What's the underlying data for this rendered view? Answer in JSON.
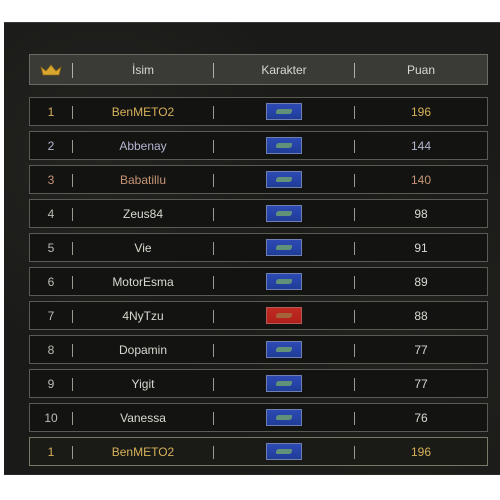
{
  "header": {
    "col_name": "İsim",
    "col_character": "Karakter",
    "col_points": "Puan",
    "rank_icon": "crown-icon"
  },
  "rows": [
    {
      "rank": "1",
      "name": "BenMETO2",
      "points": "196",
      "empire": "blue"
    },
    {
      "rank": "2",
      "name": "Abbenay",
      "points": "144",
      "empire": "blue"
    },
    {
      "rank": "3",
      "name": "Babatillu",
      "points": "140",
      "empire": "blue"
    },
    {
      "rank": "4",
      "name": "Zeus84",
      "points": "98",
      "empire": "blue"
    },
    {
      "rank": "5",
      "name": "Vie",
      "points": "91",
      "empire": "blue"
    },
    {
      "rank": "6",
      "name": "MotorEsma",
      "points": "89",
      "empire": "blue"
    },
    {
      "rank": "7",
      "name": "4NyTzu",
      "points": "88",
      "empire": "red"
    },
    {
      "rank": "8",
      "name": "Dopamin",
      "points": "77",
      "empire": "blue"
    },
    {
      "rank": "9",
      "name": "Yigit",
      "points": "77",
      "empire": "blue"
    },
    {
      "rank": "10",
      "name": "Vanessa",
      "points": "76",
      "empire": "blue"
    }
  ],
  "self_row": {
    "rank": "1",
    "name": "BenMETO2",
    "points": "196",
    "empire": "blue"
  },
  "colors": {
    "gold": "#d7b15a",
    "silver": "#b3b6cf",
    "bronze": "#c69476",
    "blue_flag": "#2644a8",
    "red_flag": "#b01f18"
  }
}
